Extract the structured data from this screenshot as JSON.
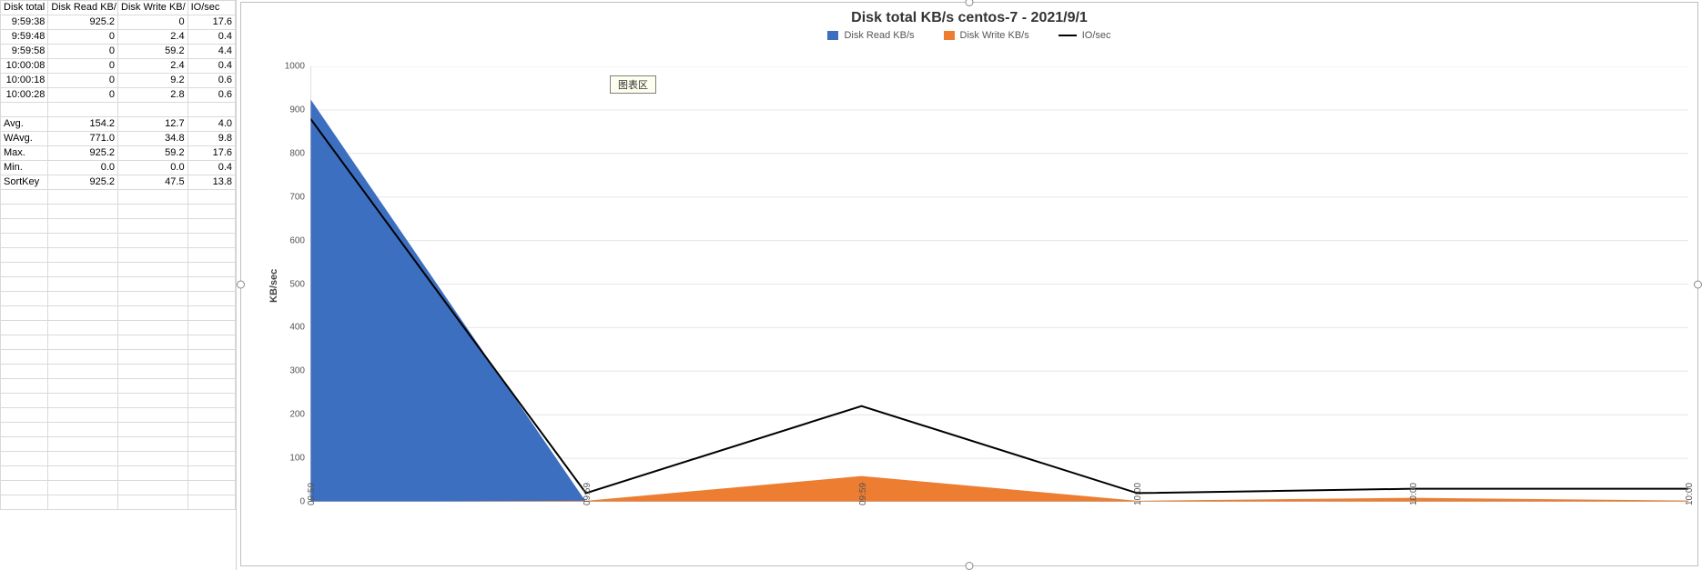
{
  "table": {
    "headers": [
      "Disk total",
      "Disk Read KB/",
      "Disk Write KB/",
      "IO/sec"
    ],
    "rows": [
      {
        "t": "9:59:38",
        "r": "925.2",
        "w": "0",
        "io": "17.6"
      },
      {
        "t": "9:59:48",
        "r": "0",
        "w": "2.4",
        "io": "0.4"
      },
      {
        "t": "9:59:58",
        "r": "0",
        "w": "59.2",
        "io": "4.4"
      },
      {
        "t": "10:00:08",
        "r": "0",
        "w": "2.4",
        "io": "0.4"
      },
      {
        "t": "10:00:18",
        "r": "0",
        "w": "9.2",
        "io": "0.6"
      },
      {
        "t": "10:00:28",
        "r": "0",
        "w": "2.8",
        "io": "0.6"
      }
    ],
    "stats": [
      {
        "lab": "Avg.",
        "r": "154.2",
        "w": "12.7",
        "io": "4.0"
      },
      {
        "lab": "WAvg.",
        "r": "771.0",
        "w": "34.8",
        "io": "9.8"
      },
      {
        "lab": "Max.",
        "r": "925.2",
        "w": "59.2",
        "io": "17.6"
      },
      {
        "lab": "Min.",
        "r": "0.0",
        "w": "0.0",
        "io": "0.4"
      },
      {
        "lab": "SortKey",
        "r": "925.2",
        "w": "47.5",
        "io": "13.8"
      }
    ],
    "empty_rows_after": 22
  },
  "chart": {
    "title": "Disk total KB/s centos-7 - 2021/9/1",
    "tooltip": "图表区",
    "ylabel": "KB/sec",
    "legend": [
      {
        "name": "Disk Read KB/s",
        "color": "#3d6fc1",
        "type": "area"
      },
      {
        "name": "Disk Write KB/s",
        "color": "#ed7d31",
        "type": "area"
      },
      {
        "name": "IO/sec",
        "color": "#000000",
        "type": "line"
      }
    ],
    "y_ticks": [
      0,
      100,
      200,
      300,
      400,
      500,
      600,
      700,
      800,
      900,
      1000
    ],
    "y_max": 1000,
    "x_labels": [
      "09:59",
      "09:59",
      "09:59",
      "10:00",
      "10:00",
      "10:00"
    ],
    "io_scale": 50
  },
  "chart_data": {
    "type": "area",
    "title": "Disk total KB/s centos-7 - 2021/9/1",
    "xlabel": "",
    "ylabel": "KB/sec",
    "ylim": [
      0,
      1000
    ],
    "categories": [
      "09:59:38",
      "09:59:48",
      "09:59:58",
      "10:00:08",
      "10:00:18",
      "10:00:28"
    ],
    "x_tick_labels": [
      "09:59",
      "09:59",
      "09:59",
      "10:00",
      "10:00",
      "10:00"
    ],
    "series": [
      {
        "name": "Disk Read KB/s",
        "type": "area",
        "color": "#3d6fc1",
        "values": [
          925.2,
          0,
          0,
          0,
          0,
          0
        ]
      },
      {
        "name": "Disk Write KB/s",
        "type": "area",
        "color": "#ed7d31",
        "values": [
          0,
          2.4,
          59.2,
          2.4,
          9.2,
          2.8
        ]
      },
      {
        "name": "IO/sec",
        "type": "line",
        "color": "#000000",
        "secondary_axis_note": "visually scaled ~×50 on primary axis",
        "values": [
          17.6,
          0.4,
          4.4,
          0.4,
          0.6,
          0.6
        ]
      }
    ],
    "legend_position": "top"
  }
}
